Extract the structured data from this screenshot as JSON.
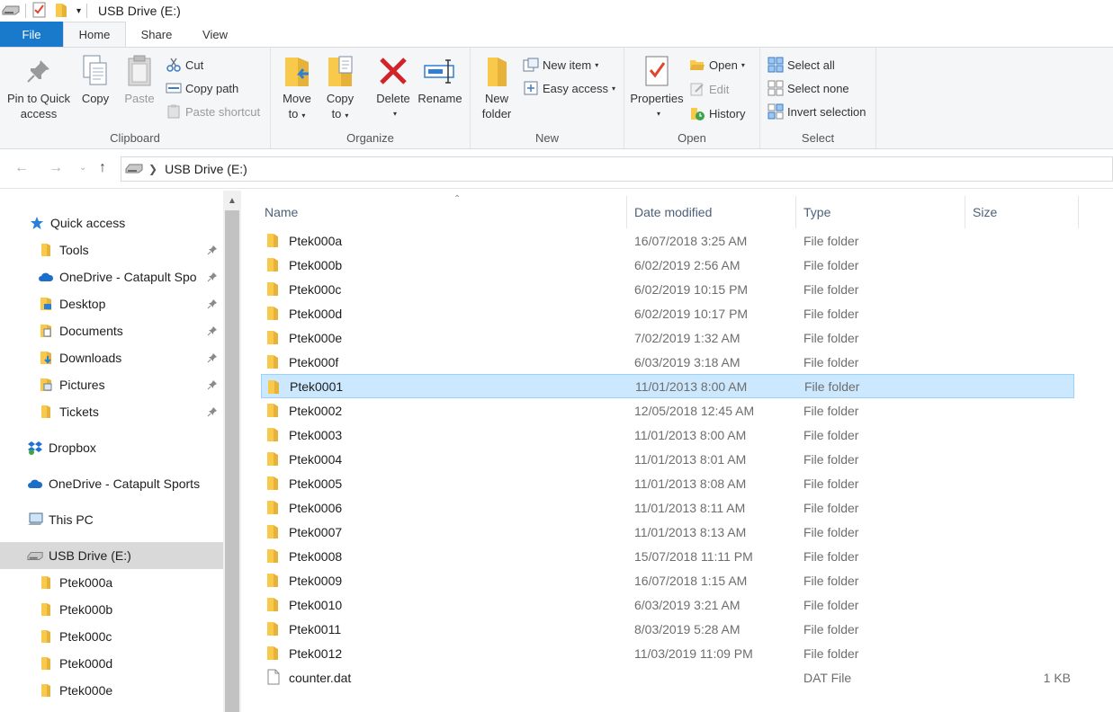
{
  "window": {
    "title": "USB Drive (E:)"
  },
  "tabs": {
    "file": "File",
    "home": "Home",
    "share": "Share",
    "view": "View"
  },
  "ribbon": {
    "clipboard": {
      "label": "Clipboard",
      "pin_line1": "Pin to Quick",
      "pin_line2": "access",
      "copy": "Copy",
      "paste": "Paste",
      "cut": "Cut",
      "copy_path": "Copy path",
      "paste_shortcut": "Paste shortcut"
    },
    "organize": {
      "label": "Organize",
      "move_to": "Move",
      "move_to2": "to",
      "copy_to": "Copy",
      "copy_to2": "to",
      "delete": "Delete",
      "rename": "Rename"
    },
    "new": {
      "label": "New",
      "new_folder1": "New",
      "new_folder2": "folder",
      "new_item": "New item",
      "easy_access": "Easy access"
    },
    "open": {
      "label": "Open",
      "properties": "Properties",
      "open": "Open",
      "edit": "Edit",
      "history": "History"
    },
    "select": {
      "label": "Select",
      "select_all": "Select all",
      "select_none": "Select none",
      "invert_selection": "Invert selection"
    }
  },
  "address": {
    "path": "USB Drive (E:)"
  },
  "sidebar": {
    "items": [
      {
        "label": "Quick access",
        "icon": "star-icon"
      },
      {
        "label": "Tools",
        "icon": "folder-icon",
        "pinned": true
      },
      {
        "label": "OneDrive - Catapult Spo",
        "icon": "onedrive-icon",
        "pinned": true
      },
      {
        "label": "Desktop",
        "icon": "desktop-folder-icon",
        "pinned": true
      },
      {
        "label": "Documents",
        "icon": "documents-folder-icon",
        "pinned": true
      },
      {
        "label": "Downloads",
        "icon": "downloads-folder-icon",
        "pinned": true
      },
      {
        "label": "Pictures",
        "icon": "pictures-folder-icon",
        "pinned": true
      },
      {
        "label": "Tickets",
        "icon": "folder-icon",
        "pinned": true
      },
      {
        "label": "Dropbox",
        "icon": "dropbox-icon"
      },
      {
        "label": "OneDrive - Catapult Sports",
        "icon": "onedrive-icon"
      },
      {
        "label": "This PC",
        "icon": "computer-icon"
      },
      {
        "label": "USB Drive (E:)",
        "icon": "drive-icon",
        "selected": true
      },
      {
        "label": "Ptek000a",
        "icon": "folder-icon"
      },
      {
        "label": "Ptek000b",
        "icon": "folder-icon"
      },
      {
        "label": "Ptek000c",
        "icon": "folder-icon"
      },
      {
        "label": "Ptek000d",
        "icon": "folder-icon"
      },
      {
        "label": "Ptek000e",
        "icon": "folder-icon"
      }
    ]
  },
  "filelist": {
    "columns": {
      "name": "Name",
      "date": "Date modified",
      "type": "Type",
      "size": "Size"
    },
    "rows": [
      {
        "name": "Ptek000a",
        "date": "16/07/2018 3:25 AM",
        "type": "File folder",
        "size": ""
      },
      {
        "name": "Ptek000b",
        "date": "6/02/2019 2:56 AM",
        "type": "File folder",
        "size": ""
      },
      {
        "name": "Ptek000c",
        "date": "6/02/2019 10:15 PM",
        "type": "File folder",
        "size": ""
      },
      {
        "name": "Ptek000d",
        "date": "6/02/2019 10:17 PM",
        "type": "File folder",
        "size": ""
      },
      {
        "name": "Ptek000e",
        "date": "7/02/2019 1:32 AM",
        "type": "File folder",
        "size": ""
      },
      {
        "name": "Ptek000f",
        "date": "6/03/2019 3:18 AM",
        "type": "File folder",
        "size": ""
      },
      {
        "name": "Ptek0001",
        "date": "11/01/2013 8:00 AM",
        "type": "File folder",
        "size": "",
        "selected": true
      },
      {
        "name": "Ptek0002",
        "date": "12/05/2018 12:45 AM",
        "type": "File folder",
        "size": ""
      },
      {
        "name": "Ptek0003",
        "date": "11/01/2013 8:00 AM",
        "type": "File folder",
        "size": ""
      },
      {
        "name": "Ptek0004",
        "date": "11/01/2013 8:01 AM",
        "type": "File folder",
        "size": ""
      },
      {
        "name": "Ptek0005",
        "date": "11/01/2013 8:08 AM",
        "type": "File folder",
        "size": ""
      },
      {
        "name": "Ptek0006",
        "date": "11/01/2013 8:11 AM",
        "type": "File folder",
        "size": ""
      },
      {
        "name": "Ptek0007",
        "date": "11/01/2013 8:13 AM",
        "type": "File folder",
        "size": ""
      },
      {
        "name": "Ptek0008",
        "date": "15/07/2018 11:11 PM",
        "type": "File folder",
        "size": ""
      },
      {
        "name": "Ptek0009",
        "date": "16/07/2018 1:15 AM",
        "type": "File folder",
        "size": ""
      },
      {
        "name": "Ptek0010",
        "date": "6/03/2019 3:21 AM",
        "type": "File folder",
        "size": ""
      },
      {
        "name": "Ptek0011",
        "date": "8/03/2019 5:28 AM",
        "type": "File folder",
        "size": ""
      },
      {
        "name": "Ptek0012",
        "date": "11/03/2019 11:09 PM",
        "type": "File folder",
        "size": ""
      },
      {
        "name": "counter.dat",
        "date": "",
        "type": "DAT File",
        "size": "1 KB",
        "is_file": true
      }
    ]
  },
  "colors": {
    "accent": "#1979ca",
    "selection": "#cce8ff",
    "folder": "#f8c94b"
  }
}
